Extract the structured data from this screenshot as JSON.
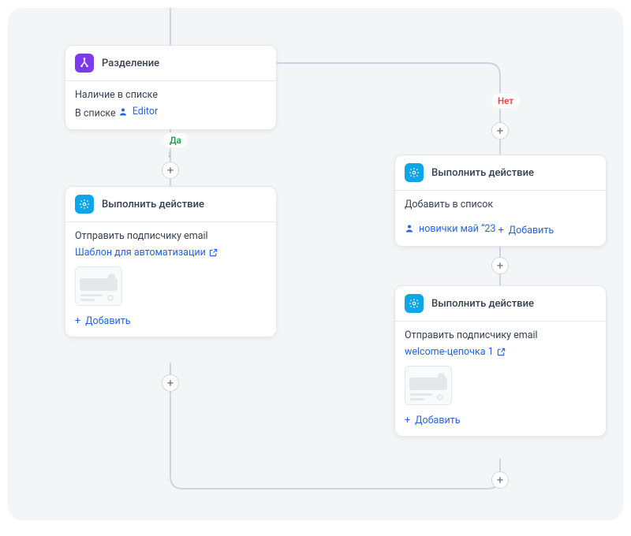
{
  "split": {
    "title": "Разделение",
    "condition_label": "Наличие в списке",
    "condition_prefix": "В списке",
    "condition_link": "Editor"
  },
  "branches": {
    "yes_label": "Да",
    "no_label": "Нет"
  },
  "yes_action": {
    "title": "Выполнить действие",
    "body_label": "Отправить подписчику email",
    "template_link": "Шаблон для автоматизации",
    "add_label": "Добавить"
  },
  "no_action1": {
    "title": "Выполнить действие",
    "body_label": "Добавить в список",
    "list_link": "новички май “23",
    "add_label": "Добавить"
  },
  "no_action2": {
    "title": "Выполнить действие",
    "body_label": "Отправить подписчику email",
    "template_link": "welcome-цепочка 1",
    "add_label": "Добавить"
  }
}
